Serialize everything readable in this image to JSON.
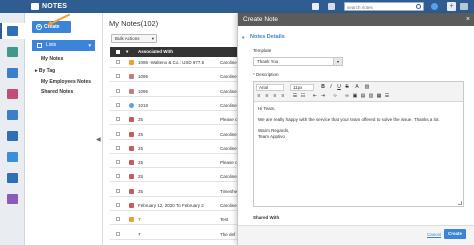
{
  "app": {
    "name": "NOTES"
  },
  "colors": {
    "brand": "#2f5d92",
    "accent": "#3c84d8",
    "header_dark": "#343434",
    "panel_head": "#5b5b5b",
    "annotation": "#f0a030"
  },
  "topbar": {
    "search_placeholder": "search notes",
    "add_label": "+"
  },
  "sidebar": {
    "create_label": "Create",
    "lists_label": "Lists",
    "items": [
      {
        "label": "My Notes"
      },
      {
        "label": "By Tag"
      },
      {
        "label": "My Employees Notes"
      },
      {
        "label": "Shared Notes"
      }
    ],
    "by_tag_expander": "▸"
  },
  "main": {
    "title": "My Notes(102)",
    "bulk_actions_label": "Bulk Actions",
    "columns": {
      "associated_with": "Associated With"
    },
    "rows": [
      {
        "assoc": "1095 -Walteno & Co.: USD 977.50",
        "owner": "Caroline",
        "icon": "img"
      },
      {
        "assoc": "1095",
        "owner": "Caroline",
        "icon": "doc"
      },
      {
        "assoc": "1095",
        "owner": "Caroline",
        "icon": "doc"
      },
      {
        "assoc": "1019",
        "owner": "Caroline",
        "icon": "cloud"
      },
      {
        "assoc": "25",
        "owner": "Please c",
        "icon": "note"
      },
      {
        "assoc": "25",
        "owner": "Caroline",
        "icon": "note"
      },
      {
        "assoc": "25",
        "owner": "Caroline",
        "icon": "note"
      },
      {
        "assoc": "25",
        "owner": "Please c",
        "icon": "note"
      },
      {
        "assoc": "25",
        "owner": "Caroline",
        "icon": "note"
      },
      {
        "assoc": "25",
        "owner": "Timeshe",
        "icon": "note"
      },
      {
        "assoc": "February 12, 2020 To February 21, 2020",
        "owner": "Caroline",
        "icon": "note"
      },
      {
        "assoc": "?",
        "owner": "Test",
        "icon": "img"
      },
      {
        "assoc": "7",
        "owner": "The def",
        "icon": "none"
      }
    ]
  },
  "panel": {
    "title": "Create Note",
    "close_label": "×",
    "section_title": "Notes Details",
    "template_label": "Template",
    "template_value": "Thank You",
    "description_label": "Description",
    "required_mark": "*",
    "font_family": "Arial",
    "font_size": "11px",
    "content": [
      "Hi Team,",
      "We are really happy with the service that your team offered to solve the issue. Thanks a lot.",
      "Warm Regards,",
      "Team Apptivo"
    ],
    "shared_with_label": "Shared With",
    "cancel_label": "Cancel",
    "create_label": "Create"
  }
}
